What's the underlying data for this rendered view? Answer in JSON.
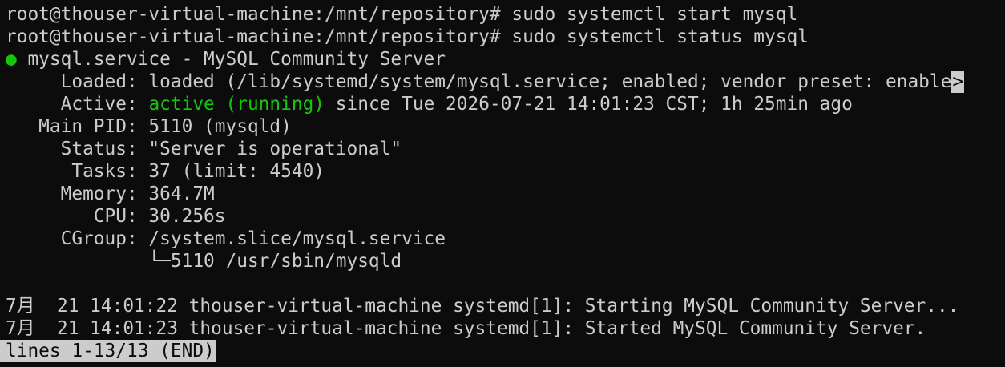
{
  "terminal": {
    "lines": [
      {
        "text": "root@thouser-virtual-machine:/mnt/repository# sudo systemctl start mysql"
      },
      {
        "text": "root@thouser-virtual-machine:/mnt/repository# sudo systemctl status mysql"
      },
      {
        "bullet": "●",
        "text": " mysql.service - MySQL Community Server"
      },
      {
        "label": "     Loaded: ",
        "text": "loaded (/lib/systemd/system/mysql.service; enabled; vendor preset: enable",
        "trunc": ">"
      },
      {
        "label": "     Active: ",
        "status": "active (running)",
        "text": " since Tue 2026-07-21 14:01:23 CST; 1h 25min ago"
      },
      {
        "text": "   Main PID: 5110 (mysqld)"
      },
      {
        "text": "     Status: \"Server is operational\""
      },
      {
        "text": "      Tasks: 37 (limit: 4540)"
      },
      {
        "text": "     Memory: 364.7M"
      },
      {
        "text": "        CPU: 30.256s"
      },
      {
        "text": "     CGroup: /system.slice/mysql.service"
      },
      {
        "text": "             └─5110 /usr/sbin/mysqld"
      },
      {
        "text": ""
      },
      {
        "text": "7月  21 14:01:22 thouser-virtual-machine systemd[1]: Starting MySQL Community Server..."
      },
      {
        "text": "7月  21 14:01:23 thouser-virtual-machine systemd[1]: Started MySQL Community Server."
      }
    ],
    "pager_status": "lines 1-13/13 (END)"
  },
  "colors": {
    "background": "#0c0c0c",
    "foreground": "#cccccc",
    "status_green": "#16c60c"
  }
}
